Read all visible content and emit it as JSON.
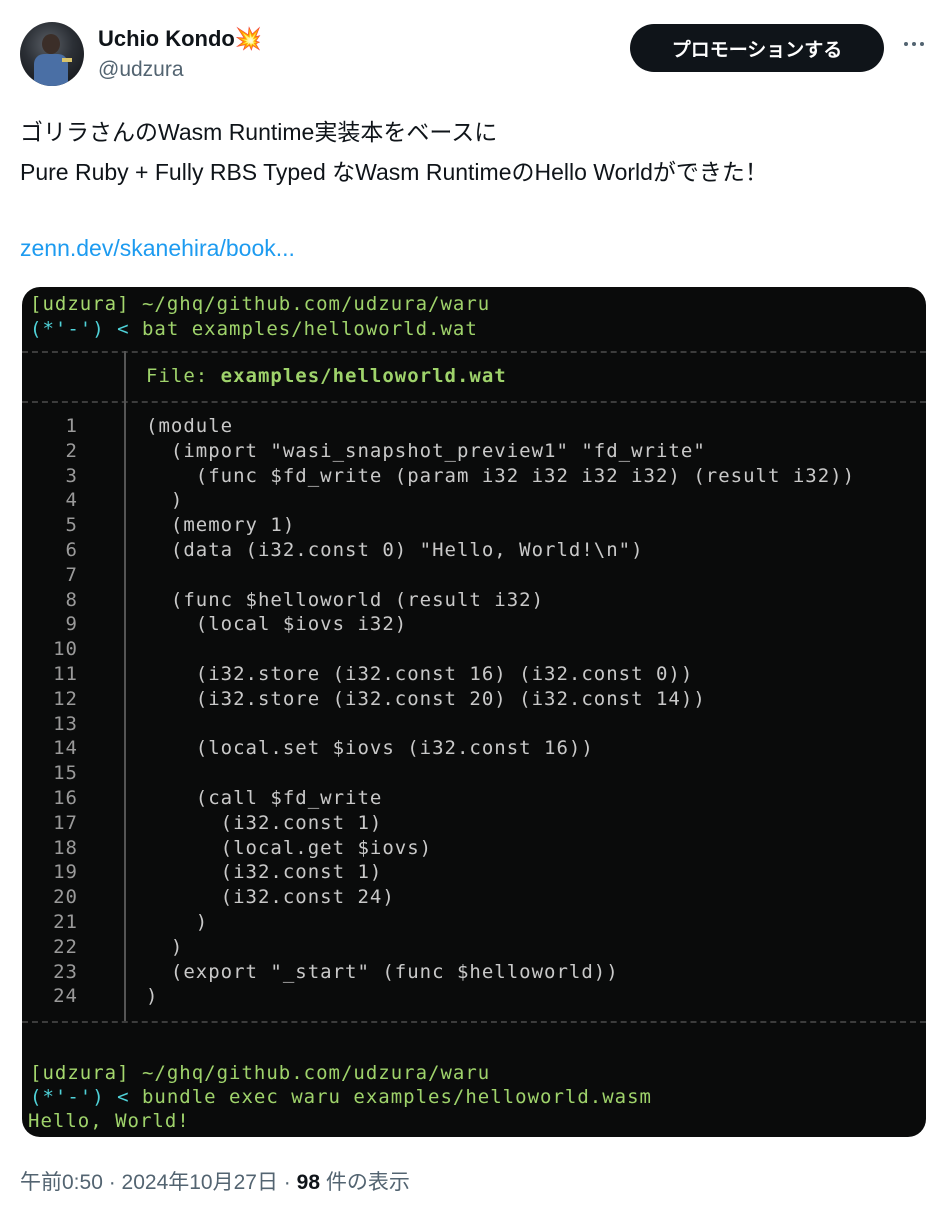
{
  "author": {
    "name": "Uchio Kondo",
    "emoji": "💥",
    "handle": "@udzura"
  },
  "promote_label": "プロモーションする",
  "more_icon": "more-horizontal-icon",
  "tweet": {
    "lines": [
      "ゴリラさんのWasm Runtime実装本をベースに",
      "Pure Ruby + Fully RBS Typed なWasm RuntimeのHello Worldができた！"
    ],
    "link": "zenn.dev/skanehira/book..."
  },
  "terminal": {
    "prompt1_user": "[udzura]",
    "prompt1_path": " ~/ghq/github.com/udzura/waru",
    "prompt1_face": "(*'-') <",
    "prompt1_cmd": " bat examples/helloworld.wat",
    "file_label": "File: ",
    "file_name": "examples/helloworld.wat",
    "code_lines": [
      "(module",
      "  (import \"wasi_snapshot_preview1\" \"fd_write\"",
      "    (func $fd_write (param i32 i32 i32 i32) (result i32))",
      "  )",
      "  (memory 1)",
      "  (data (i32.const 0) \"Hello, World!\\n\")",
      "",
      "  (func $helloworld (result i32)",
      "    (local $iovs i32)",
      "",
      "    (i32.store (i32.const 16) (i32.const 0))",
      "    (i32.store (i32.const 20) (i32.const 14))",
      "",
      "    (local.set $iovs (i32.const 16))",
      "",
      "    (call $fd_write",
      "      (i32.const 1)",
      "      (local.get $iovs)",
      "      (i32.const 1)",
      "      (i32.const 24)",
      "    )",
      "  )",
      "  (export \"_start\" (func $helloworld))",
      ")"
    ],
    "prompt2_user": "[udzura]",
    "prompt2_path": " ~/ghq/github.com/udzura/waru",
    "prompt2_face": "(*'-') <",
    "prompt2_cmd": " bundle exec waru examples/helloworld.wasm",
    "output": "Hello, World!"
  },
  "footer": {
    "time": "午前0:50 · 2024年10月27日 · ",
    "views": "98",
    "views_label": " 件の表示"
  }
}
